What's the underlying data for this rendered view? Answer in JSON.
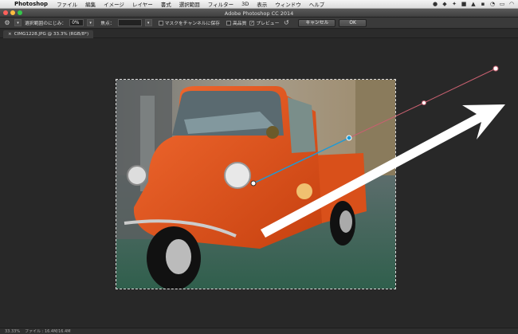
{
  "menubar": {
    "app": "Photoshop",
    "items": [
      "ファイル",
      "編集",
      "イメージ",
      "レイヤー",
      "書式",
      "選択範囲",
      "フィルター",
      "3D",
      "表示",
      "ウィンドウ",
      "ヘルプ"
    ]
  },
  "window": {
    "title": "Adobe Photoshop CC 2014"
  },
  "options": {
    "edge_blur_label": "選択範囲のにじみ：",
    "edge_blur_value": "0%",
    "focus_label": "焦点：",
    "save_mask_label": "マスクをチャンネルに保存",
    "high_quality_label": "高品質",
    "preview_label": "プレビュー",
    "preview_checked": "✓",
    "cancel_label": "キャンセル",
    "ok_label": "OK"
  },
  "document": {
    "tab_label": "CIMG1228.JPG @ 33.3% (RGB/8*)",
    "tab_close": "×"
  },
  "status": {
    "zoom": "33.33%",
    "info": "ファイル : 16.4M/16.4M"
  },
  "colors": {
    "accent_path": "#c86070",
    "handle_blue": "#1e9ad6",
    "truck": "#e2501c"
  }
}
